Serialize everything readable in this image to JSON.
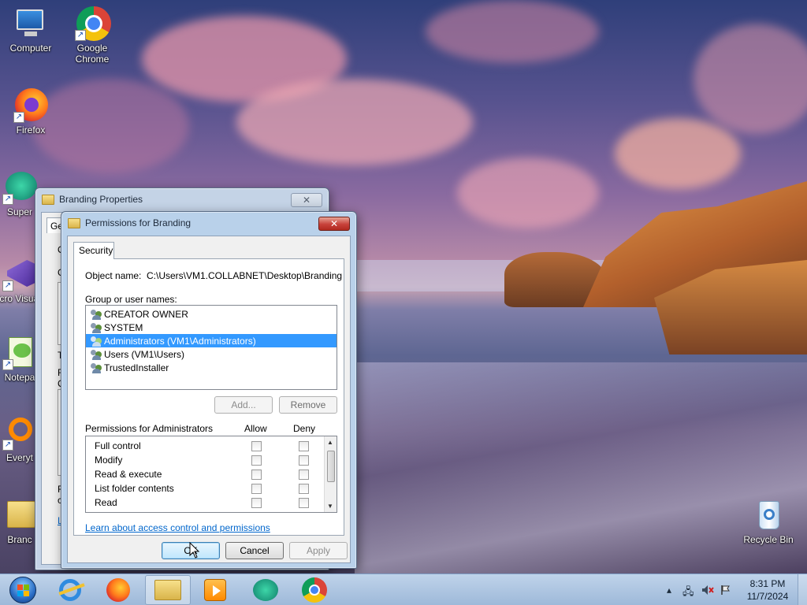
{
  "desktop": {
    "icons": [
      {
        "label": "Computer"
      },
      {
        "label": "Google Chrome"
      },
      {
        "label": "Firefox"
      },
      {
        "label": "Super"
      },
      {
        "label": "Micro Visual S"
      },
      {
        "label": "Notepa"
      },
      {
        "label": "Everyt"
      },
      {
        "label": "Branc"
      },
      {
        "label": "Recycle Bin"
      }
    ]
  },
  "branding_window": {
    "title": "Branding Properties",
    "tab_fragment": "Ge",
    "left_fragments": [
      "O",
      "G",
      "T",
      "F",
      "C",
      "F",
      "c",
      "L"
    ]
  },
  "perm_dialog": {
    "title": "Permissions for Branding",
    "tab": "Security",
    "object_name_label": "Object name:",
    "object_name_value": "C:\\Users\\VM1.COLLABNET\\Desktop\\Branding",
    "group_label": "Group or user names:",
    "users": [
      {
        "name": "CREATOR OWNER",
        "selected": false
      },
      {
        "name": "SYSTEM",
        "selected": false
      },
      {
        "name": "Administrators (VM1\\Administrators)",
        "selected": true
      },
      {
        "name": "Users (VM1\\Users)",
        "selected": false
      },
      {
        "name": "TrustedInstaller",
        "selected": false
      }
    ],
    "add_button": "Add...",
    "remove_button": "Remove",
    "permissions_label": "Permissions for Administrators",
    "allow_header": "Allow",
    "deny_header": "Deny",
    "permissions": [
      {
        "name": "Full control"
      },
      {
        "name": "Modify"
      },
      {
        "name": "Read & execute"
      },
      {
        "name": "List folder contents"
      },
      {
        "name": "Read"
      }
    ],
    "learn_link": "Learn about access control and permissions",
    "ok_button": "OK",
    "cancel_button": "Cancel",
    "apply_button": "Apply"
  },
  "taskbar": {
    "time": "8:31 PM",
    "date": "11/7/2024"
  },
  "colors": {
    "selection": "#3399ff",
    "link": "#0066cc",
    "close_button": "#c7413a"
  }
}
